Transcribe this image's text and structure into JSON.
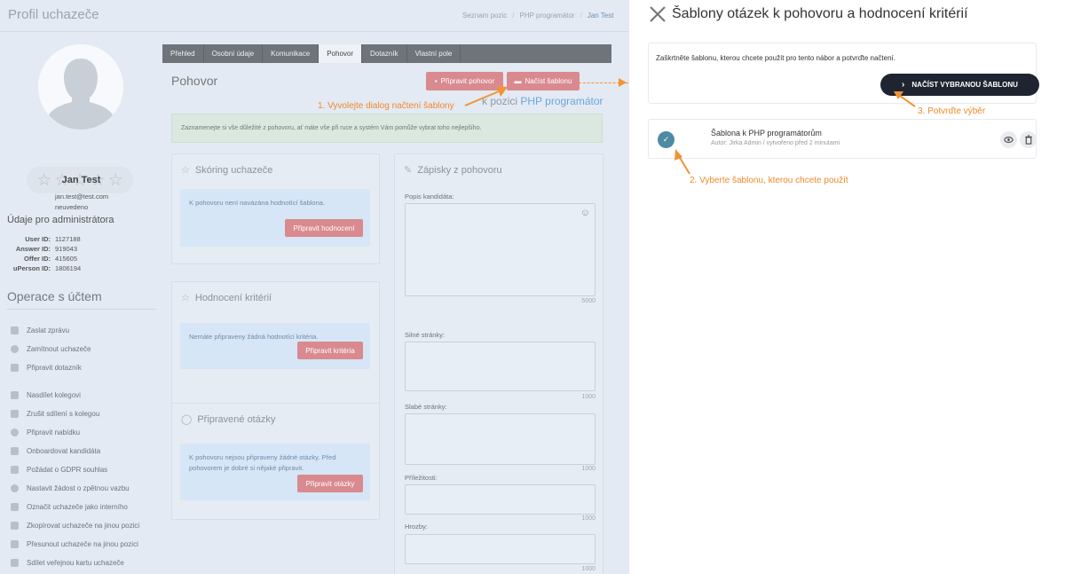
{
  "header": {
    "title": "Profil uchazeče",
    "breadcrumb": [
      "Seznam pozic",
      "PHP programátor",
      "Jan Test"
    ]
  },
  "candidate": {
    "name": "Jan Test",
    "email": "jan.test@test.com",
    "phone": "neuvedeno",
    "rating_stars": 5
  },
  "admin": {
    "title": "Údaje pro administrátora",
    "rows": [
      {
        "label": "User ID:",
        "value": "1127188"
      },
      {
        "label": "Answer ID:",
        "value": "919043"
      },
      {
        "label": "Offer ID:",
        "value": "415605"
      },
      {
        "label": "uPerson ID:",
        "value": "1806194"
      }
    ]
  },
  "operations": {
    "title": "Operace s účtem",
    "items": [
      {
        "label": "Zaslat zprávu",
        "icon": "envelope-icon"
      },
      {
        "label": "Zamítnout uchazeče",
        "icon": "reject-icon"
      },
      {
        "label": "Připravit dotazník",
        "icon": "edit-icon"
      },
      {
        "label": "Nasdílet kolegovi",
        "icon": "user-share-icon"
      },
      {
        "label": "Zrušit sdílení s kolegou",
        "icon": "user-unshare-icon"
      },
      {
        "label": "Připravit nabídku",
        "icon": "offer-icon"
      },
      {
        "label": "Onboardovat kandidáta",
        "icon": "briefcase-icon"
      },
      {
        "label": "Požádat o GDPR souhlas",
        "icon": "gdpr-icon"
      },
      {
        "label": "Nastavit žádost o zpětnou vazbu",
        "icon": "feedback-icon"
      },
      {
        "label": "Označit uchazeče jako interního",
        "icon": "id-card-icon"
      },
      {
        "label": "Zkopírovat uchazeče na jinou pozici",
        "icon": "copy-icon"
      },
      {
        "label": "Přesunout uchazeče na jinou pozici",
        "icon": "move-icon"
      },
      {
        "label": "Sdílet veřejnou kartu uchazeče",
        "icon": "cloud-share-icon"
      }
    ]
  },
  "tabs": [
    "Přehled",
    "Osobní údaje",
    "Komunikace",
    "Pohovor",
    "Dotazník",
    "Vlastní pole"
  ],
  "active_tab": "Pohovor",
  "interview": {
    "title": "Pohovor",
    "btn_prepare": "Připravit pohovor",
    "btn_load": "Načíst šablonu",
    "position_prefix": "k pozici",
    "position_name": "PHP programátor",
    "note": "Zaznamenejte si vše důležité z pohovoru, ať máte vše při ruce a systém Vám pomůže vybrat toho nejlepšího.",
    "scoring": {
      "title": "Skóring uchazeče",
      "info": "K pohovoru není navázána hodnotící šablona.",
      "button": "Připravit hodnocení"
    },
    "criteria": {
      "title": "Hodnocení kritérií",
      "info": "Nemáte připraveny žádná hodnotící kritéria.",
      "button": "Připravit kritéria"
    },
    "questions": {
      "title": "Připravené otázky",
      "info": "K pohovoru nejsou připraveny žádné otázky. Před pohovorem je dobré si nějaké připravit.",
      "button": "Připravit otázky"
    },
    "notes": {
      "title": "Zápisky z pohovoru",
      "fields": [
        {
          "label": "Popis kandidáta:",
          "max": "5000"
        },
        {
          "label": "Silné stránky:",
          "max": "1000"
        },
        {
          "label": "Slabé stránky:",
          "max": "1000"
        },
        {
          "label": "Příležitosti:",
          "max": "1000"
        },
        {
          "label": "Hrozby:",
          "max": "1000"
        }
      ]
    }
  },
  "drawer": {
    "title": "Šablony otázek k pohovoru a hodnocení kritérií",
    "instructions": "Zaškrtněte šablonu, kterou chcete použít pro tento nábor a potvrďte načtení.",
    "load_button": "NAČÍST VYBRANOU ŠABLONU",
    "template": {
      "name": "Šablona k PHP programátorům",
      "meta": "Autor: Jirka Admin / vytvořeno před 2 minutami"
    }
  },
  "annotations": {
    "step1": "1. Vyvolejte dialog načtení šablony",
    "step2": "2. Vyberte šablonu, kterou chcete použít",
    "step3": "3. Potvrďte výběr"
  },
  "colors": {
    "accent_orange": "#f29333",
    "red_button": "#d98a8f",
    "dark_button": "#1f2431",
    "link_blue": "#6da5d8"
  }
}
